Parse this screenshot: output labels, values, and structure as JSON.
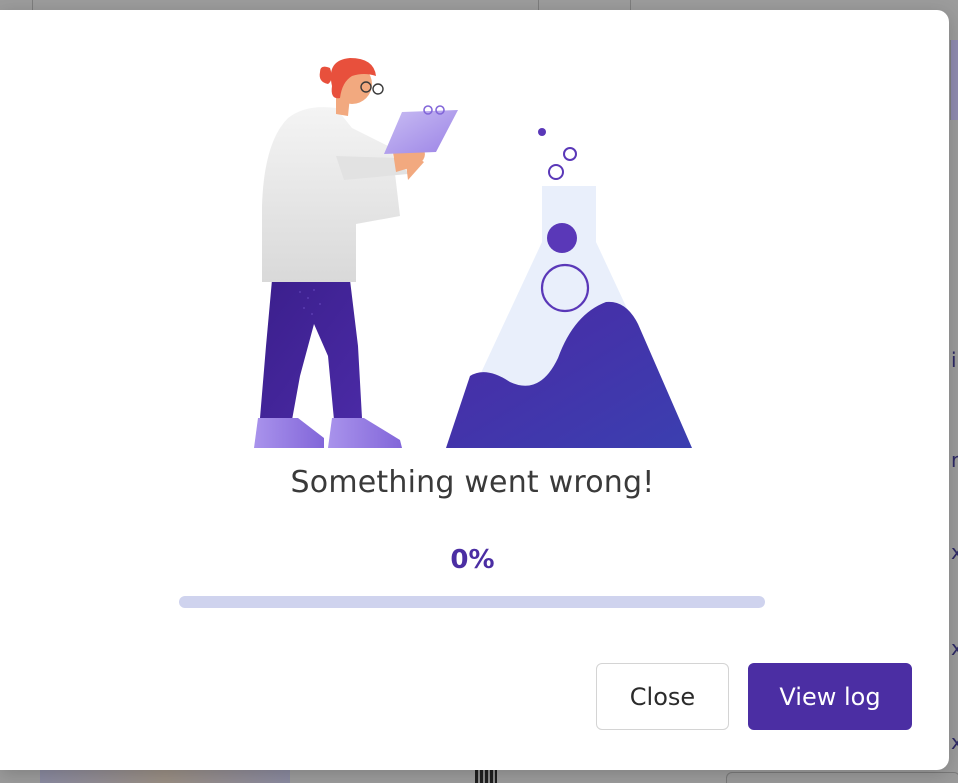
{
  "dialog": {
    "message": "Something went wrong!",
    "progress": {
      "label": "0%",
      "value": 0
    },
    "buttons": {
      "close_label": "Close",
      "view_log_label": "View log"
    }
  },
  "background": {
    "right_glyphs": [
      "i",
      "r",
      "x",
      "x",
      "x"
    ]
  },
  "colors": {
    "accent": "#4b2ea3",
    "progress_track": "#cfd3ee",
    "text": "#3a3a3a",
    "hair": "#e8503c",
    "coat": "#e6e6e6",
    "flask_glass": "#e9effb"
  },
  "icons": {
    "illustration": "scientist-with-flask-illustration"
  }
}
